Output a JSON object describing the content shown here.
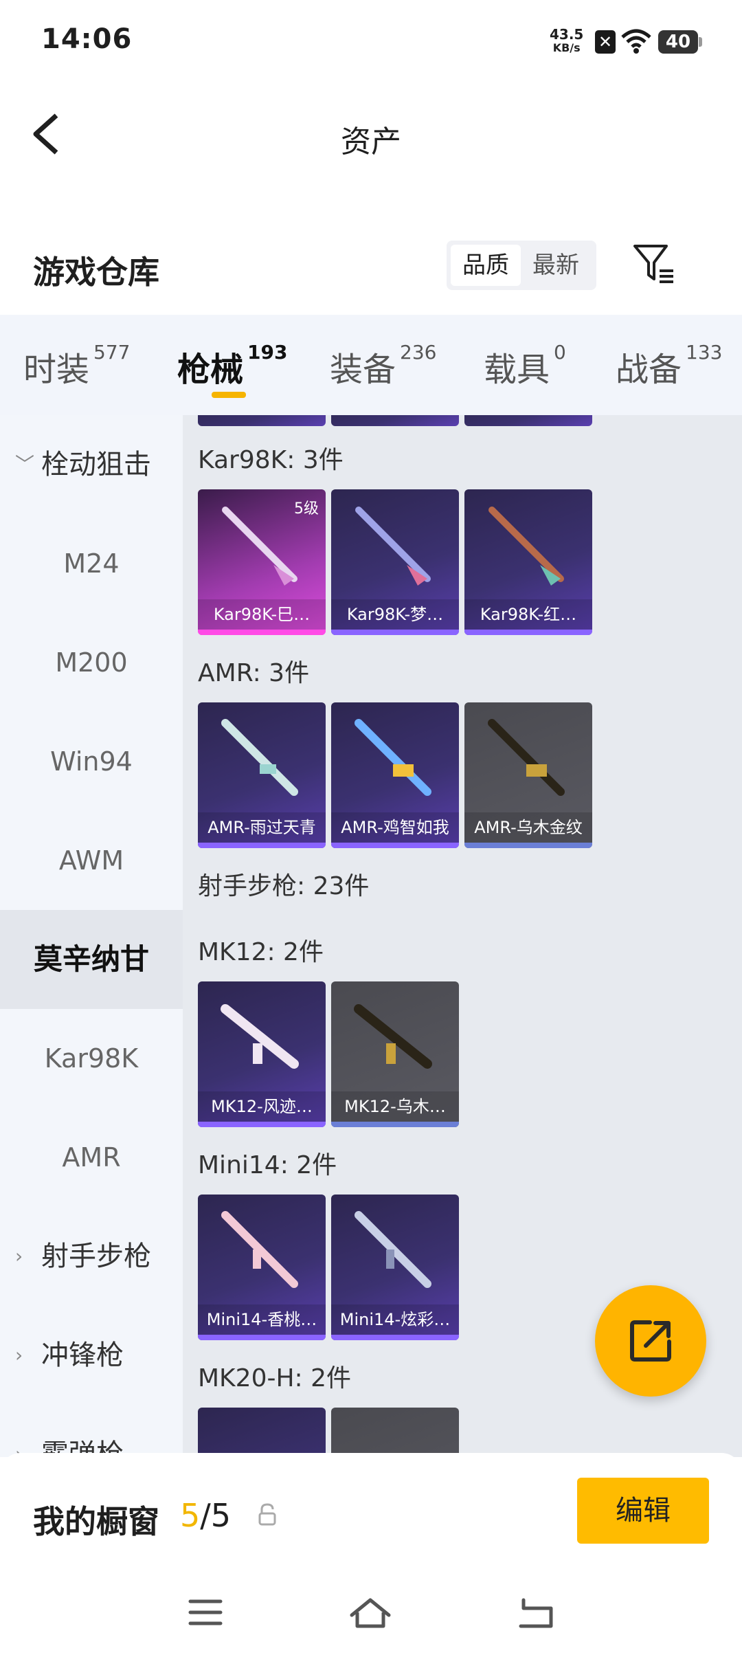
{
  "status_bar": {
    "time": "14:06",
    "net_speed_value": "43.5",
    "net_speed_unit": "KB/s",
    "battery": "40"
  },
  "header": {
    "title": "资产"
  },
  "section": {
    "title": "游戏仓库",
    "sort_options": [
      "品质",
      "最新"
    ]
  },
  "tabs": [
    {
      "label": "时装",
      "count": "577"
    },
    {
      "label": "枪械",
      "count": "193"
    },
    {
      "label": "装备",
      "count": "236"
    },
    {
      "label": "载具",
      "count": "0"
    },
    {
      "label": "战备",
      "count": "133"
    }
  ],
  "sidebar": {
    "items": [
      {
        "label": "栓动狙击"
      },
      {
        "label": "M24"
      },
      {
        "label": "M200"
      },
      {
        "label": "Win94"
      },
      {
        "label": "AWM"
      },
      {
        "label": "莫辛纳甘"
      },
      {
        "label": "Kar98K"
      },
      {
        "label": "AMR"
      },
      {
        "label": "射手步枪"
      },
      {
        "label": "冲锋枪"
      },
      {
        "label": "霰弹枪"
      }
    ]
  },
  "content": {
    "groups": [
      {
        "label": "Kar98K: 3件",
        "items": [
          {
            "name": "Kar98K-巳…",
            "level": "5级",
            "quality": "pink"
          },
          {
            "name": "Kar98K-梦…",
            "quality": "purple"
          },
          {
            "name": "Kar98K-红…",
            "quality": "purple"
          }
        ]
      },
      {
        "label": "AMR: 3件",
        "items": [
          {
            "name": "AMR-雨过天青",
            "quality": "purple"
          },
          {
            "name": "AMR-鸡智如我",
            "quality": "purple"
          },
          {
            "name": "AMR-乌木金纹",
            "quality": "gray"
          }
        ]
      },
      {
        "label": "射手步枪: 23件"
      },
      {
        "label": "MK12: 2件",
        "items": [
          {
            "name": "MK12-风迹…",
            "quality": "purple"
          },
          {
            "name": "MK12-乌木…",
            "quality": "gray"
          }
        ]
      },
      {
        "label": "Mini14: 2件",
        "items": [
          {
            "name": "Mini14-香桃…",
            "quality": "purple"
          },
          {
            "name": "Mini14-炫彩…",
            "quality": "purple"
          }
        ]
      },
      {
        "label": "MK20-H: 2件"
      }
    ]
  },
  "shelf": {
    "title": "我的橱窗",
    "current": "5",
    "total": "/5",
    "edit_label": "编辑"
  },
  "colors": {
    "accent": "#ffb400",
    "pink_quality": "#e04de0",
    "purple_quality": "#5a3fb0"
  },
  "icons": [
    "back-arrow-icon",
    "filter-icon",
    "share-out-icon",
    "lock-icon",
    "menu-icon",
    "home-icon",
    "back-icon"
  ]
}
